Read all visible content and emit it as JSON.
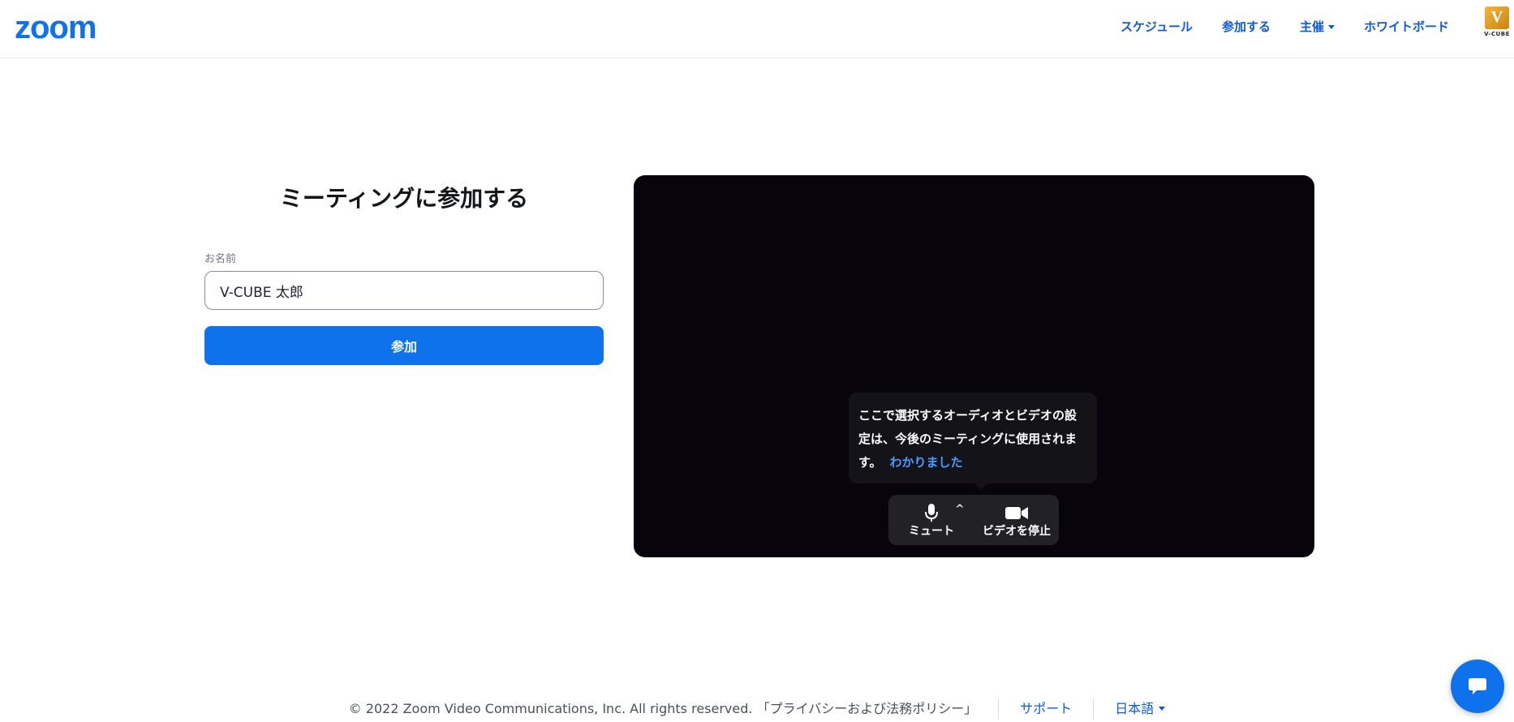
{
  "header": {
    "logo_text": "zoom",
    "nav": [
      {
        "label": "スケジュール"
      },
      {
        "label": "参加する"
      },
      {
        "label": "主催"
      },
      {
        "label": "ホワイトボード"
      }
    ],
    "brand_text": "V-CUBE"
  },
  "join": {
    "title": "ミーティングに参加する",
    "name_label": "お名前",
    "name_value": "V-CUBE 太郎",
    "join_button": "参加"
  },
  "preview": {
    "tooltip_text": "ここで選択するオーディオとビデオの設定は、今後のミーティングに使用されます。",
    "tooltip_ack": "わかりました",
    "mute_label": "ミュート",
    "video_label": "ビデオを停止",
    "caret": "^"
  },
  "footer": {
    "copyright": "© 2022 Zoom Video Communications, Inc. All rights reserved. 「プライバシーおよび法務ポリシー」",
    "support": "サポート",
    "language": "日本語"
  },
  "colors": {
    "accent": "#0e72ed",
    "link": "#0e5bd8",
    "preview_bg": "#07040c"
  }
}
